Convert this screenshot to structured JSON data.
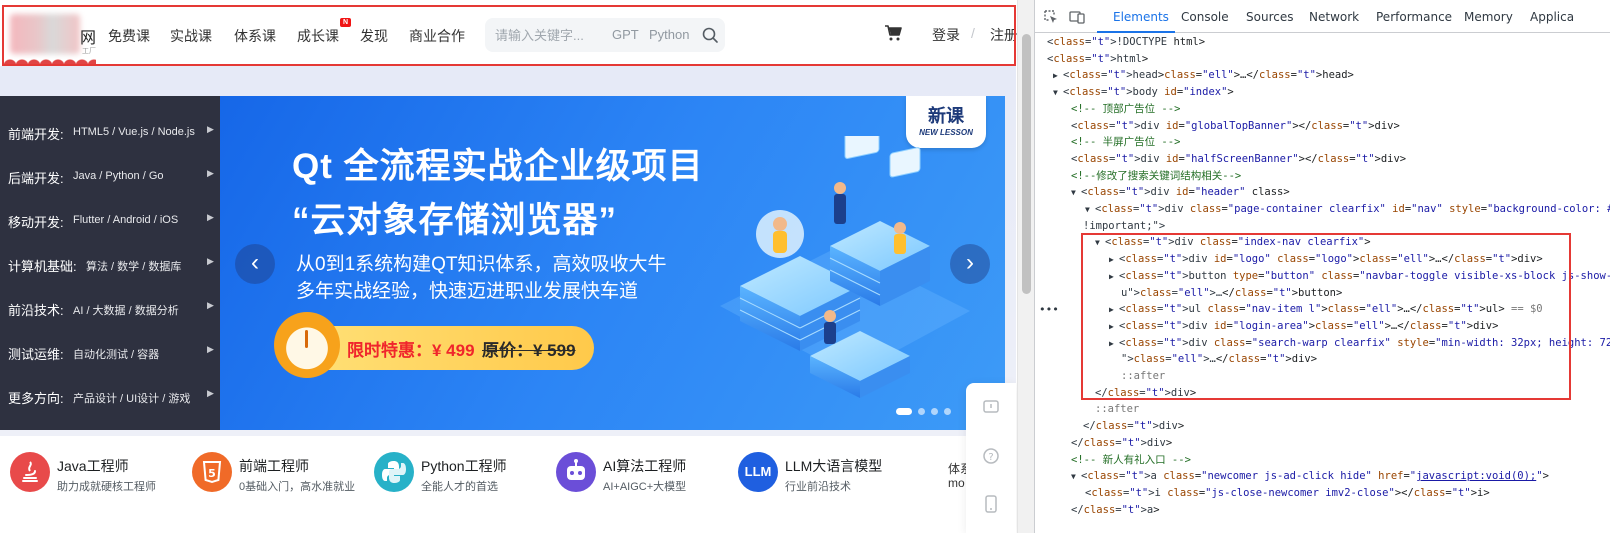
{
  "nav": {
    "logo_suffix": "网",
    "logo_sub": "工厂",
    "items": [
      "免费课",
      "实战课",
      "体系课",
      "成长课",
      "发现",
      "商业合作"
    ],
    "new_badge": "N",
    "search_placeholder": "请输入关键字...",
    "hot_tags": [
      "GPT",
      "Python"
    ],
    "login": "登录",
    "separator": "/",
    "register": "注册"
  },
  "side_menu": [
    {
      "category": "前端开发:",
      "sub": "HTML5 / Vue.js / Node.js"
    },
    {
      "category": "后端开发:",
      "sub": "Java / Python / Go"
    },
    {
      "category": "移动开发:",
      "sub": "Flutter / Android / iOS"
    },
    {
      "category": "计算机基础:",
      "sub": "算法 / 数学 / 数据库"
    },
    {
      "category": "前沿技术:",
      "sub": "AI / 大数据 / 数据分析"
    },
    {
      "category": "测试运维:",
      "sub": "自动化测试 / 容器"
    },
    {
      "category": "更多方向:",
      "sub": "产品设计 / UI设计 / 游戏"
    }
  ],
  "banner": {
    "title_line1": "Qt 全流程实战企业级项目",
    "title_line2": "“云对象存储浏览器”",
    "desc_line1": "从0到1系统构建QT知识体系，高效吸收大牛",
    "desc_line2": "多年实战经验，快速迈进职业发展快车道",
    "promo_price": "限时特惠：¥ 499",
    "original_price": "原价：¥ 599",
    "badge_cn": "新课",
    "badge_en": "NEW LESSON",
    "prev_arrow": "‹",
    "next_arrow": "›"
  },
  "careers": [
    {
      "name": "Java工程师",
      "desc": "助力成就硬核工程师",
      "icon": "java-icon",
      "color": "#e84a4a"
    },
    {
      "name": "前端工程师",
      "desc": "0基础入门，高水准就业",
      "icon": "html5-icon",
      "color": "#f06a28"
    },
    {
      "name": "Python工程师",
      "desc": "全能人才的首选",
      "icon": "python-icon",
      "color": "#27b1c8"
    },
    {
      "name": "AI算法工程师",
      "desc": "AI+AIGC+大模型",
      "icon": "robot-icon",
      "color": "#6b4ed8"
    },
    {
      "name": "LLM大语言模型",
      "desc": "行业前沿技术",
      "icon_text": "LLM",
      "color": "#1f5fe0"
    }
  ],
  "career_more": {
    "line1": "体系",
    "line2": "mo"
  },
  "devtools": {
    "tabs": [
      "Elements",
      "Console",
      "Sources",
      "Network",
      "Performance",
      "Memory",
      "Applica"
    ],
    "active_tab": "Elements",
    "lines": [
      {
        "text": "<!DOCTYPE html>"
      },
      {
        "text": "<html>"
      },
      {
        "text": "<head> … </head>"
      },
      {
        "text": "<body id=\"index\">"
      },
      {
        "text": "<!-- 顶部广告位 -->"
      },
      {
        "text": "<div id=\"globalTopBanner\"></div>"
      },
      {
        "text": "<!-- 半屏广告位 -->"
      },
      {
        "text": "<div id=\"halfScreenBanner\"></div>"
      },
      {
        "text": "<!--修改了搜索关键词结构相关-->"
      },
      {
        "text": "<div id=\"header\" class>"
      },
      {
        "text": "<div class=\"page-container clearfix\" id=\"nav\" style=\"background-color: #fff"
      },
      {
        "text": "!important;\">"
      },
      {
        "text": "<div class=\"index-nav clearfix\">"
      },
      {
        "text": "<div id=\"logo\" class=\"logo\"> … </div>"
      },
      {
        "text": "<button type=\"button\" class=\"navbar-toggle visible-xs-block js-show-men"
      },
      {
        "text": "u\"> … </button>"
      },
      {
        "text": "<ul class=\"nav-item l\"> … </ul> == $0"
      },
      {
        "text": "<div id=\"login-area\"> … </div>"
      },
      {
        "text": "<div class=\"search-warp clearfix\" style=\"min-width: 32px; height: 72px;"
      },
      {
        "text": "\"> … </div>"
      },
      {
        "text": "::after"
      },
      {
        "text": "</div>"
      },
      {
        "text": "::after"
      },
      {
        "text": "</div>"
      },
      {
        "text": "</div>"
      },
      {
        "text": "<!-- 新人有礼入口 -->"
      },
      {
        "text": "<a class=\"newcomer js-ad-click hide\" href=\"javascript:void(0);\">"
      },
      {
        "text": "<i class=\"js-close-newcomer imv2-close\"></i>"
      },
      {
        "text": "</a>"
      }
    ]
  }
}
